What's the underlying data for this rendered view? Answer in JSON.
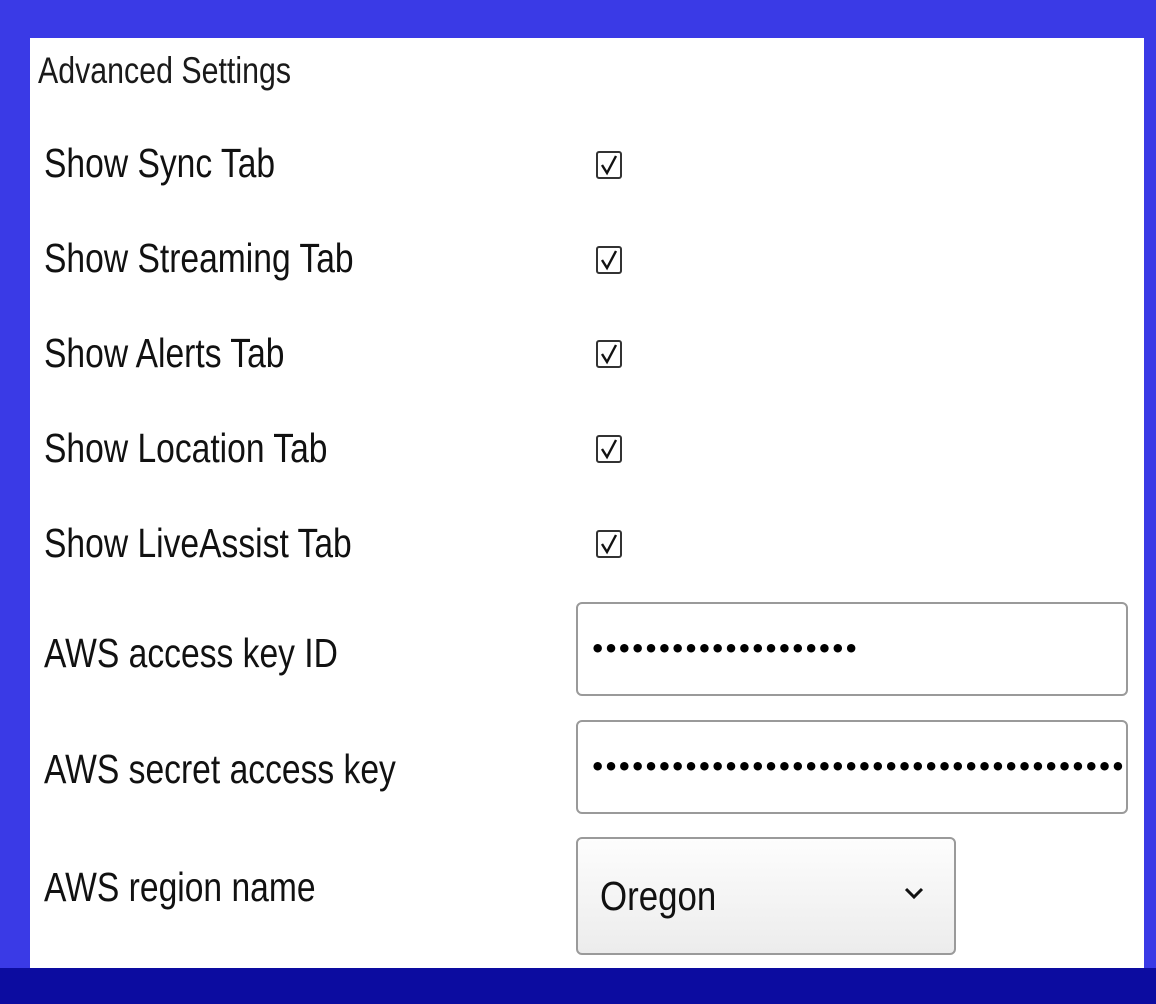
{
  "panel": {
    "title": "Advanced Settings"
  },
  "settings": [
    {
      "label": "Show Sync Tab",
      "checked": true
    },
    {
      "label": "Show Streaming Tab",
      "checked": true
    },
    {
      "label": "Show Alerts Tab",
      "checked": true
    },
    {
      "label": "Show Location Tab",
      "checked": true
    },
    {
      "label": "Show LiveAssist Tab",
      "checked": true
    }
  ],
  "aws": {
    "access_key_label": "AWS access key ID",
    "access_key_value": "••••••••••••••••••••",
    "secret_key_label": "AWS secret access key",
    "secret_key_value": "••••••••••••••••••••••••••••••••••••••••",
    "region_label": "AWS region name",
    "region_value": "Oregon"
  },
  "icons": {
    "checkbox_mark": "checkmark-icon",
    "select_arrow": "chevron-down-icon"
  },
  "colors": {
    "frame_top": "#3a3ae6",
    "frame_bottom": "#0c0ca0",
    "panel_bg": "#ffffff"
  }
}
